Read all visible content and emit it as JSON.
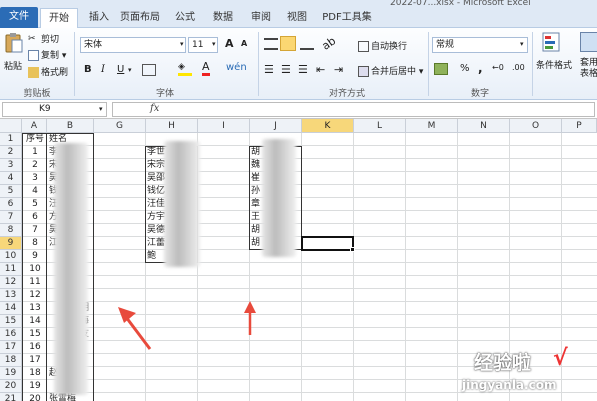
{
  "window_title": "2022-07...xlsx - Microsoft Excel",
  "tabs": [
    "文件",
    "开始",
    "插入",
    "页面布局",
    "公式",
    "数据",
    "审阅",
    "视图",
    "PDF工具集"
  ],
  "ribbon": {
    "clipboard": {
      "paste": "粘贴",
      "cut": "剪切",
      "copy": "复制",
      "format_painter": "格式刷",
      "label": "剪贴板"
    },
    "font": {
      "name": "宋体",
      "size": "11",
      "grow": "A",
      "shrink": "A",
      "bold": "B",
      "italic": "I",
      "underline": "U",
      "label": "字体",
      "wen": "wén"
    },
    "alignment": {
      "wrap": "自动换行",
      "merge": "合并后居中",
      "label": "对齐方式"
    },
    "number": {
      "format": "常规",
      "percent": "%",
      "comma": ",",
      "label": "数字"
    },
    "styles": {
      "conditional": "条件格式",
      "table": "套用\n表格格式"
    }
  },
  "formula_bar": {
    "name_box": "K9",
    "fx": "fx",
    "formula": ""
  },
  "columns": [
    "A",
    "B",
    "G",
    "H",
    "I",
    "J",
    "K",
    "L",
    "M",
    "N",
    "O",
    "P"
  ],
  "selected_column": "K",
  "rows": [
    "1",
    "2",
    "3",
    "4",
    "5",
    "6",
    "7",
    "8",
    "9",
    "10",
    "11",
    "12",
    "13",
    "14",
    "15",
    "16",
    "17",
    "18",
    "19",
    "20",
    "21"
  ],
  "selected_row": "9",
  "colA_values": [
    "序号",
    "1",
    "2",
    "3",
    "4",
    "5",
    "6",
    "7",
    "8",
    "9",
    "10",
    "11",
    "12",
    "13",
    "14",
    "15",
    "16",
    "17",
    "18",
    "19",
    "20"
  ],
  "colB_header": "姓名",
  "colB_visible": [
    "李",
    "宋",
    "吴",
    "钱",
    "汪",
    "方",
    "吴",
    "江",
    "",
    "",
    "",
    "",
    "",
    "",
    "",
    "",
    "",
    "",
    "",
    "赵",
    "张霄梅"
  ],
  "colB_suffix": [
    "",
    "",
    "",
    "",
    "",
    "",
    "",
    "",
    "",
    "",
    "",
    "",
    "",
    "",
    "",
    "",
    "",
    "",
    "",
    "",
    "汪"
  ],
  "colH_values": [
    "李世",
    "宋宗",
    "吴邵",
    "钱亿",
    "汪佳",
    "方宇",
    "吴德",
    "江蕾",
    "鲍"
  ],
  "colJ_values": [
    "胡",
    "魏",
    "崔",
    "孙",
    "章",
    "王",
    "胡",
    "胡"
  ],
  "colB_right": [
    "",
    "",
    "",
    "",
    "",
    "",
    "",
    "",
    "",
    "",
    "",
    "",
    "",
    "明",
    "海",
    "友",
    "",
    "",
    "",
    "",
    ""
  ],
  "watermark": {
    "line1": "经验啦",
    "check": "√",
    "line2": "jingyanla.com"
  }
}
